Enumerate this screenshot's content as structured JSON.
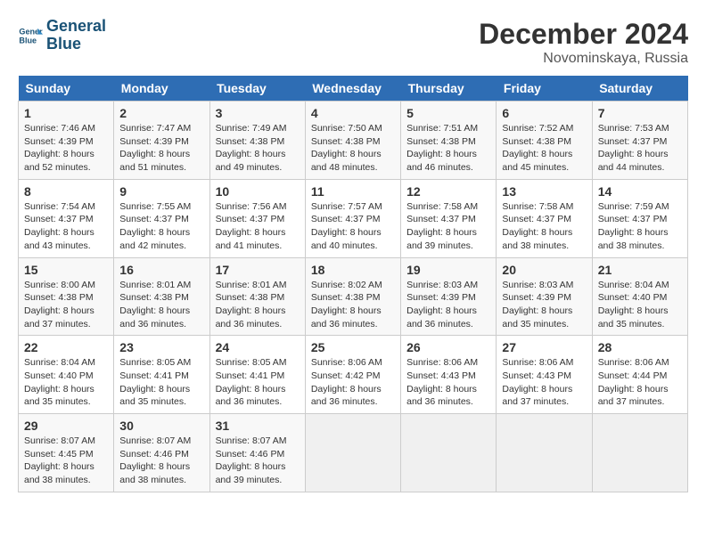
{
  "header": {
    "logo_line1": "General",
    "logo_line2": "Blue",
    "month": "December 2024",
    "location": "Novominskaya, Russia"
  },
  "days_of_week": [
    "Sunday",
    "Monday",
    "Tuesday",
    "Wednesday",
    "Thursday",
    "Friday",
    "Saturday"
  ],
  "weeks": [
    [
      {
        "day": 1,
        "sunrise": "7:46 AM",
        "sunset": "4:39 PM",
        "daylight": "8 hours and 52 minutes."
      },
      {
        "day": 2,
        "sunrise": "7:47 AM",
        "sunset": "4:39 PM",
        "daylight": "8 hours and 51 minutes."
      },
      {
        "day": 3,
        "sunrise": "7:49 AM",
        "sunset": "4:38 PM",
        "daylight": "8 hours and 49 minutes."
      },
      {
        "day": 4,
        "sunrise": "7:50 AM",
        "sunset": "4:38 PM",
        "daylight": "8 hours and 48 minutes."
      },
      {
        "day": 5,
        "sunrise": "7:51 AM",
        "sunset": "4:38 PM",
        "daylight": "8 hours and 46 minutes."
      },
      {
        "day": 6,
        "sunrise": "7:52 AM",
        "sunset": "4:38 PM",
        "daylight": "8 hours and 45 minutes."
      },
      {
        "day": 7,
        "sunrise": "7:53 AM",
        "sunset": "4:37 PM",
        "daylight": "8 hours and 44 minutes."
      }
    ],
    [
      {
        "day": 8,
        "sunrise": "7:54 AM",
        "sunset": "4:37 PM",
        "daylight": "8 hours and 43 minutes."
      },
      {
        "day": 9,
        "sunrise": "7:55 AM",
        "sunset": "4:37 PM",
        "daylight": "8 hours and 42 minutes."
      },
      {
        "day": 10,
        "sunrise": "7:56 AM",
        "sunset": "4:37 PM",
        "daylight": "8 hours and 41 minutes."
      },
      {
        "day": 11,
        "sunrise": "7:57 AM",
        "sunset": "4:37 PM",
        "daylight": "8 hours and 40 minutes."
      },
      {
        "day": 12,
        "sunrise": "7:58 AM",
        "sunset": "4:37 PM",
        "daylight": "8 hours and 39 minutes."
      },
      {
        "day": 13,
        "sunrise": "7:58 AM",
        "sunset": "4:37 PM",
        "daylight": "8 hours and 38 minutes."
      },
      {
        "day": 14,
        "sunrise": "7:59 AM",
        "sunset": "4:37 PM",
        "daylight": "8 hours and 38 minutes."
      }
    ],
    [
      {
        "day": 15,
        "sunrise": "8:00 AM",
        "sunset": "4:38 PM",
        "daylight": "8 hours and 37 minutes."
      },
      {
        "day": 16,
        "sunrise": "8:01 AM",
        "sunset": "4:38 PM",
        "daylight": "8 hours and 36 minutes."
      },
      {
        "day": 17,
        "sunrise": "8:01 AM",
        "sunset": "4:38 PM",
        "daylight": "8 hours and 36 minutes."
      },
      {
        "day": 18,
        "sunrise": "8:02 AM",
        "sunset": "4:38 PM",
        "daylight": "8 hours and 36 minutes."
      },
      {
        "day": 19,
        "sunrise": "8:03 AM",
        "sunset": "4:39 PM",
        "daylight": "8 hours and 36 minutes."
      },
      {
        "day": 20,
        "sunrise": "8:03 AM",
        "sunset": "4:39 PM",
        "daylight": "8 hours and 35 minutes."
      },
      {
        "day": 21,
        "sunrise": "8:04 AM",
        "sunset": "4:40 PM",
        "daylight": "8 hours and 35 minutes."
      }
    ],
    [
      {
        "day": 22,
        "sunrise": "8:04 AM",
        "sunset": "4:40 PM",
        "daylight": "8 hours and 35 minutes."
      },
      {
        "day": 23,
        "sunrise": "8:05 AM",
        "sunset": "4:41 PM",
        "daylight": "8 hours and 35 minutes."
      },
      {
        "day": 24,
        "sunrise": "8:05 AM",
        "sunset": "4:41 PM",
        "daylight": "8 hours and 36 minutes."
      },
      {
        "day": 25,
        "sunrise": "8:06 AM",
        "sunset": "4:42 PM",
        "daylight": "8 hours and 36 minutes."
      },
      {
        "day": 26,
        "sunrise": "8:06 AM",
        "sunset": "4:43 PM",
        "daylight": "8 hours and 36 minutes."
      },
      {
        "day": 27,
        "sunrise": "8:06 AM",
        "sunset": "4:43 PM",
        "daylight": "8 hours and 37 minutes."
      },
      {
        "day": 28,
        "sunrise": "8:06 AM",
        "sunset": "4:44 PM",
        "daylight": "8 hours and 37 minutes."
      }
    ],
    [
      {
        "day": 29,
        "sunrise": "8:07 AM",
        "sunset": "4:45 PM",
        "daylight": "8 hours and 38 minutes."
      },
      {
        "day": 30,
        "sunrise": "8:07 AM",
        "sunset": "4:46 PM",
        "daylight": "8 hours and 38 minutes."
      },
      {
        "day": 31,
        "sunrise": "8:07 AM",
        "sunset": "4:46 PM",
        "daylight": "8 hours and 39 minutes."
      },
      null,
      null,
      null,
      null
    ]
  ],
  "labels": {
    "sunrise": "Sunrise:",
    "sunset": "Sunset:",
    "daylight": "Daylight:"
  }
}
